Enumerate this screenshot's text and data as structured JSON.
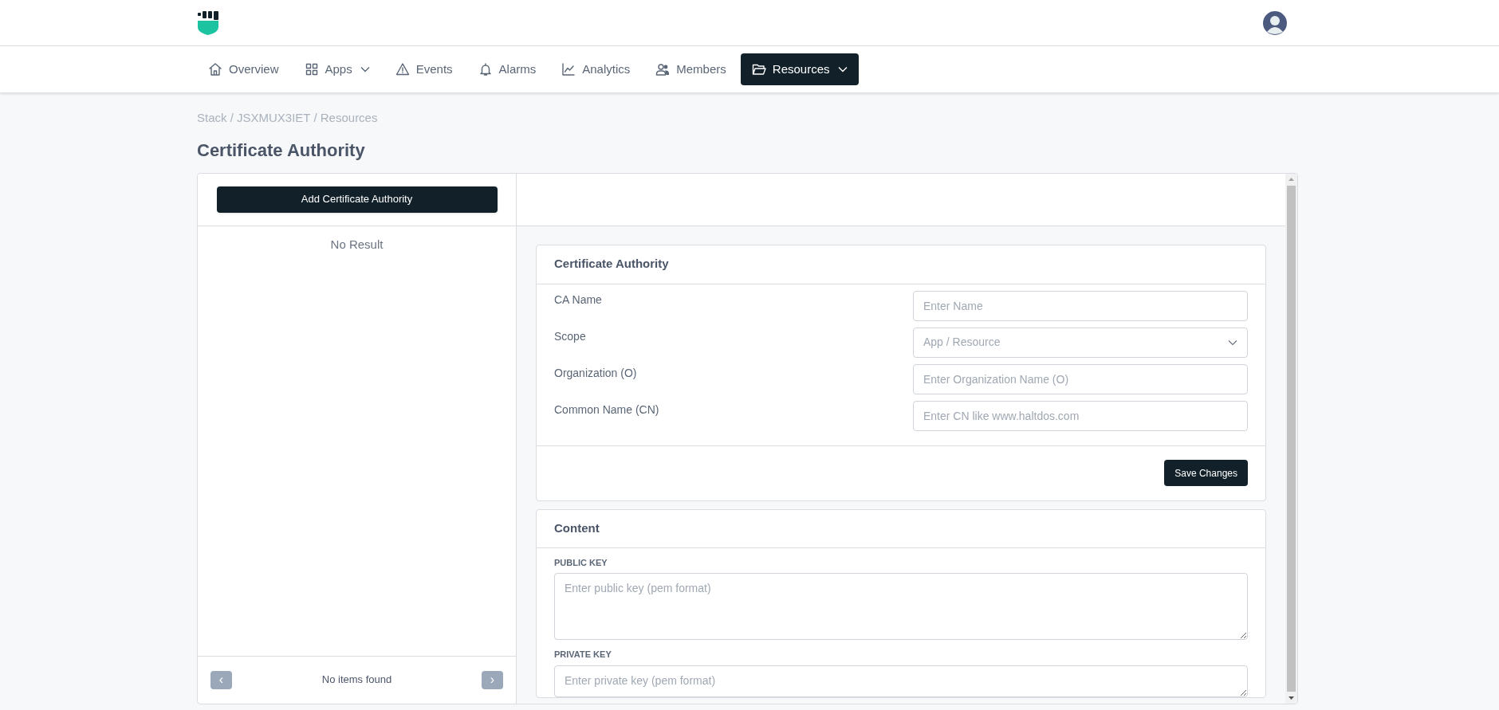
{
  "nav": {
    "items": [
      {
        "label": "Overview",
        "selected": false,
        "dropdown": false
      },
      {
        "label": "Apps",
        "selected": false,
        "dropdown": true
      },
      {
        "label": "Events",
        "selected": false,
        "dropdown": false
      },
      {
        "label": "Alarms",
        "selected": false,
        "dropdown": false
      },
      {
        "label": "Analytics",
        "selected": false,
        "dropdown": false
      },
      {
        "label": "Members",
        "selected": false,
        "dropdown": false
      },
      {
        "label": "Resources",
        "selected": true,
        "dropdown": true
      }
    ]
  },
  "breadcrumb": "Stack / JSXMUX3IET / Resources",
  "page_title": "Certificate Authority",
  "sidebar": {
    "add_button": "Add Certificate Authority",
    "empty_text": "No Result",
    "pagination": {
      "prev": "‹",
      "text": "No items found",
      "next": "›"
    }
  },
  "ca_card": {
    "title": "Certificate Authority",
    "fields": [
      {
        "kind": "text",
        "label": "CA Name",
        "placeholder": "Enter Name"
      },
      {
        "kind": "select",
        "label": "Scope",
        "placeholder": "App / Resource"
      },
      {
        "kind": "text",
        "label": "Organization (O)",
        "placeholder": "Enter Organization Name (O)"
      },
      {
        "kind": "text",
        "label": "Common Name (CN)",
        "placeholder": "Enter CN like www.haltdos.com"
      }
    ],
    "save_button": "Save Changes"
  },
  "content_card": {
    "title": "Content",
    "fields": [
      {
        "label": "PUBLIC KEY",
        "placeholder": "Enter public key (pem format)"
      },
      {
        "label": "PRIVATE KEY",
        "placeholder": "Enter private key (pem format)"
      }
    ]
  }
}
